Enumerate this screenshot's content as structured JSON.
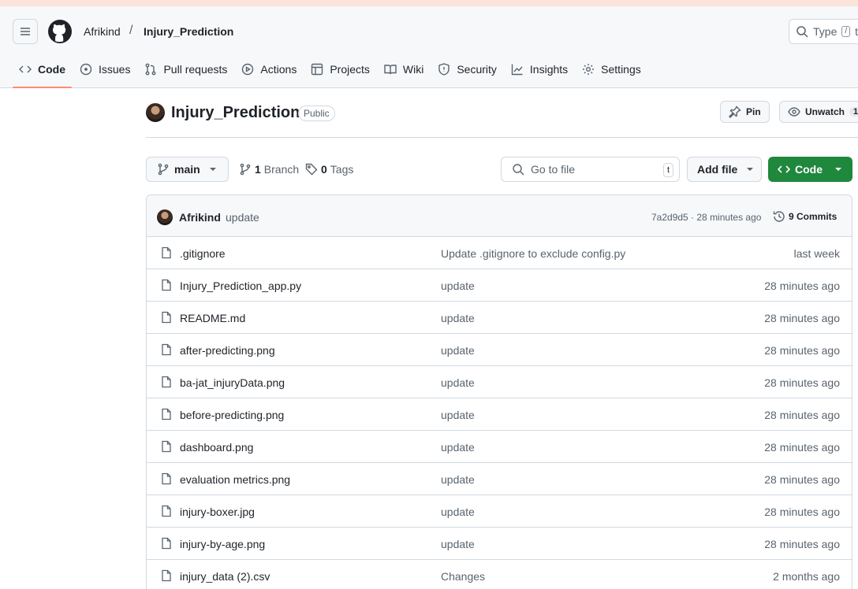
{
  "header": {
    "owner": "Afrikind",
    "separator": "/",
    "repo": "Injury_Prediction",
    "search_label": "Type",
    "search_key": "/",
    "search_trailing": "t"
  },
  "tabs": [
    {
      "label": "Code",
      "icon": "code-icon",
      "active": true
    },
    {
      "label": "Issues",
      "icon": "issue-icon"
    },
    {
      "label": "Pull requests",
      "icon": "pull-request-icon"
    },
    {
      "label": "Actions",
      "icon": "play-icon"
    },
    {
      "label": "Projects",
      "icon": "table-icon"
    },
    {
      "label": "Wiki",
      "icon": "book-icon"
    },
    {
      "label": "Security",
      "icon": "shield-icon"
    },
    {
      "label": "Insights",
      "icon": "graph-icon"
    },
    {
      "label": "Settings",
      "icon": "gear-icon"
    }
  ],
  "repo_head": {
    "title": "Injury_Prediction",
    "visibility": "Public",
    "pin_label": "Pin",
    "watch_label": "Unwatch",
    "watch_count": "1"
  },
  "toolbar": {
    "branch": "main",
    "branch_count": "1",
    "branch_label": "Branch",
    "tag_count": "0",
    "tag_label": "Tags",
    "go_to_file": "Go to file",
    "go_to_file_key": "t",
    "add_file": "Add file",
    "code_button": "Code"
  },
  "latest_commit": {
    "author": "Afrikind",
    "message": "update",
    "hash_time": "7a2d9d5 · 28 minutes ago",
    "commit_count_label": "9 Commits"
  },
  "files": [
    {
      "name": ".gitignore",
      "message": "Update .gitignore to exclude config.py",
      "date": "last week"
    },
    {
      "name": "Injury_Prediction_app.py",
      "message": "update",
      "date": "28 minutes ago"
    },
    {
      "name": "README.md",
      "message": "update",
      "date": "28 minutes ago"
    },
    {
      "name": "after-predicting.png",
      "message": "update",
      "date": "28 minutes ago"
    },
    {
      "name": "ba-jat_injuryData.png",
      "message": "update",
      "date": "28 minutes ago"
    },
    {
      "name": "before-predicting.png",
      "message": "update",
      "date": "28 minutes ago"
    },
    {
      "name": "dashboard.png",
      "message": "update",
      "date": "28 minutes ago"
    },
    {
      "name": "evaluation metrics.png",
      "message": "update",
      "date": "28 minutes ago"
    },
    {
      "name": "injury-boxer.jpg",
      "message": "update",
      "date": "28 minutes ago"
    },
    {
      "name": "injury-by-age.png",
      "message": "update",
      "date": "28 minutes ago"
    },
    {
      "name": "injury_data (2).csv",
      "message": "Changes",
      "date": "2 months ago"
    }
  ],
  "colors": {
    "accent_underline": "#fd8c73",
    "code_button": "#1f883d",
    "header_bg": "#f6f8fa"
  }
}
